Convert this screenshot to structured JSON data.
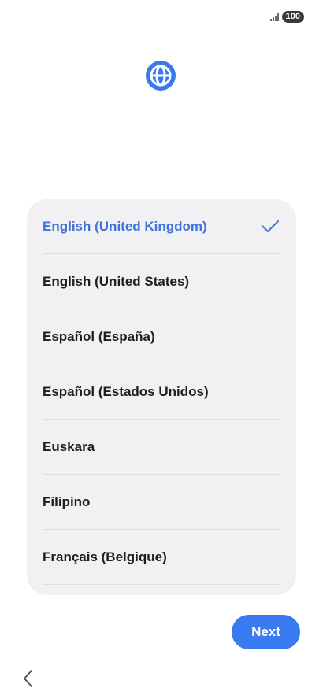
{
  "status_bar": {
    "battery_level": "100"
  },
  "header": {
    "icon": "globe-icon"
  },
  "languages": [
    {
      "label": "English (United Kingdom)",
      "selected": true
    },
    {
      "label": "English (United States)",
      "selected": false
    },
    {
      "label": "Español (España)",
      "selected": false
    },
    {
      "label": "Español (Estados Unidos)",
      "selected": false
    },
    {
      "label": "Euskara",
      "selected": false
    },
    {
      "label": "Filipino",
      "selected": false
    },
    {
      "label": "Français (Belgique)",
      "selected": false
    }
  ],
  "footer": {
    "next_label": "Next",
    "back_icon": "chevron-left-icon"
  },
  "colors": {
    "accent": "#3a7af0",
    "selected_text": "#3f73d6",
    "card_background": "#f1f1f3"
  }
}
